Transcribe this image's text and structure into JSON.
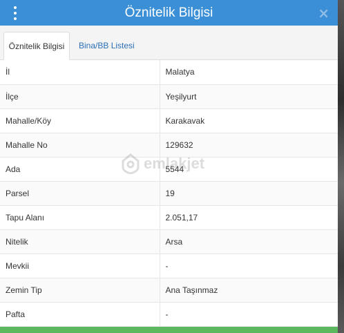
{
  "dialog": {
    "title": "Öznitelik Bilgisi",
    "close_glyph": "×"
  },
  "tabs": [
    {
      "label": "Öznitelik Bilgisi",
      "active": true
    },
    {
      "label": "Bina/BB Listesi",
      "active": false
    }
  ],
  "rows": [
    {
      "key": "İl",
      "value": "Malatya"
    },
    {
      "key": "İlçe",
      "value": "Yeşilyurt"
    },
    {
      "key": "Mahalle/Köy",
      "value": "Karakavak"
    },
    {
      "key": "Mahalle No",
      "value": "129632"
    },
    {
      "key": "Ada",
      "value": "5544"
    },
    {
      "key": "Parsel",
      "value": "19"
    },
    {
      "key": "Tapu Alanı",
      "value": "2.051,17"
    },
    {
      "key": "Nitelik",
      "value": "Arsa"
    },
    {
      "key": "Mevkii",
      "value": "-"
    },
    {
      "key": "Zemin Tip",
      "value": "Ana Taşınmaz"
    },
    {
      "key": "Pafta",
      "value": "-"
    }
  ],
  "watermark": {
    "text": "emlakjet",
    "icon": "house-pin-icon"
  },
  "colors": {
    "header": "#3a8fd6",
    "footer": "#5cb85c",
    "tab_link": "#2a6eb5"
  }
}
